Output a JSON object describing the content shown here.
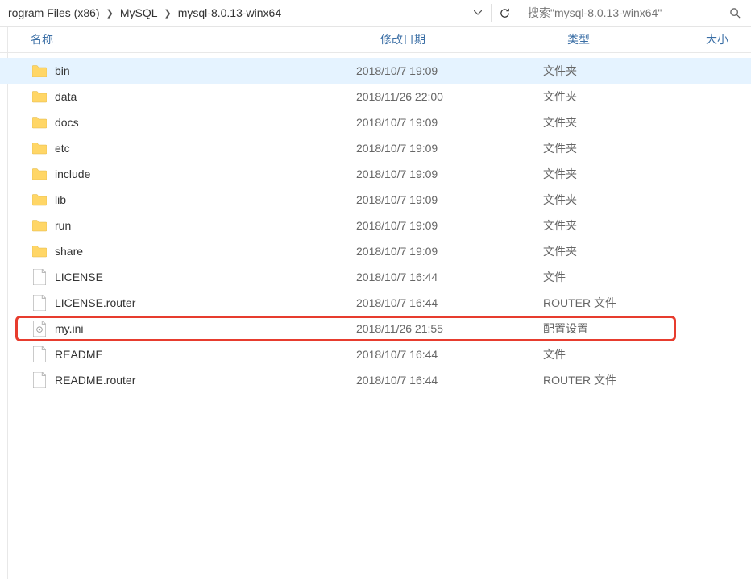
{
  "breadcrumb": {
    "item1": "rogram Files (x86)",
    "item2": "MySQL",
    "item3": "mysql-8.0.13-winx64"
  },
  "search": {
    "placeholder": "搜索\"mysql-8.0.13-winx64\""
  },
  "columns": {
    "name": "名称",
    "date": "修改日期",
    "type": "类型",
    "size": "大小"
  },
  "files": [
    {
      "name": "bin",
      "date": "2018/10/7 19:09",
      "type": "文件夹",
      "icon": "folder",
      "selected": true
    },
    {
      "name": "data",
      "date": "2018/11/26 22:00",
      "type": "文件夹",
      "icon": "folder"
    },
    {
      "name": "docs",
      "date": "2018/10/7 19:09",
      "type": "文件夹",
      "icon": "folder"
    },
    {
      "name": "etc",
      "date": "2018/10/7 19:09",
      "type": "文件夹",
      "icon": "folder"
    },
    {
      "name": "include",
      "date": "2018/10/7 19:09",
      "type": "文件夹",
      "icon": "folder"
    },
    {
      "name": "lib",
      "date": "2018/10/7 19:09",
      "type": "文件夹",
      "icon": "folder"
    },
    {
      "name": "run",
      "date": "2018/10/7 19:09",
      "type": "文件夹",
      "icon": "folder"
    },
    {
      "name": "share",
      "date": "2018/10/7 19:09",
      "type": "文件夹",
      "icon": "folder"
    },
    {
      "name": "LICENSE",
      "date": "2018/10/7 16:44",
      "type": "文件",
      "icon": "file"
    },
    {
      "name": "LICENSE.router",
      "date": "2018/10/7 16:44",
      "type": "ROUTER 文件",
      "icon": "file"
    },
    {
      "name": "my.ini",
      "date": "2018/11/26 21:55",
      "type": "配置设置",
      "icon": "ini",
      "highlighted": true
    },
    {
      "name": "README",
      "date": "2018/10/7 16:44",
      "type": "文件",
      "icon": "file"
    },
    {
      "name": "README.router",
      "date": "2018/10/7 16:44",
      "type": "ROUTER 文件",
      "icon": "file"
    }
  ]
}
